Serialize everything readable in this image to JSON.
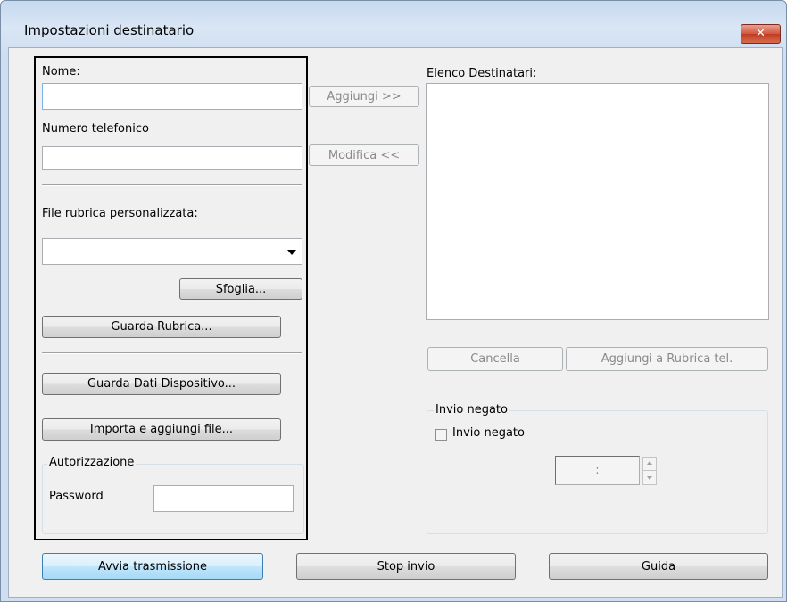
{
  "window": {
    "title": "Impostazioni destinatario",
    "close_glyph": "✕"
  },
  "left": {
    "nome_label": "Nome:",
    "nome_value": "",
    "telefono_label": "Numero telefonico",
    "telefono_value": "",
    "rubrica_label": "File rubrica personalizzata:",
    "rubrica_selected": "",
    "sfoglia_button": "Sfoglia...",
    "guarda_rubrica_button": "Guarda Rubrica...",
    "guarda_dati_button": "Guarda Dati Dispositivo...",
    "importa_button": "Importa e aggiungi file...",
    "autorizzazione_group": "Autorizzazione",
    "password_label": "Password",
    "password_value": ""
  },
  "middle": {
    "aggiungi_button": "Aggiungi  >>",
    "modifica_button": "Modifica <<"
  },
  "right": {
    "elenco_label": "Elenco Destinatari:",
    "cancella_button": "Cancella",
    "aggiungi_rubrica_button": "Aggiungi a Rubrica tel.",
    "invio_negato_group": "Invio negato",
    "invio_negato_checkbox": "Invio negato",
    "invio_negato_checked": false,
    "time_value": ":"
  },
  "bottom": {
    "avvia_button": "Avvia trasmissione",
    "stop_button": "Stop invio",
    "guida_button": "Guida"
  }
}
